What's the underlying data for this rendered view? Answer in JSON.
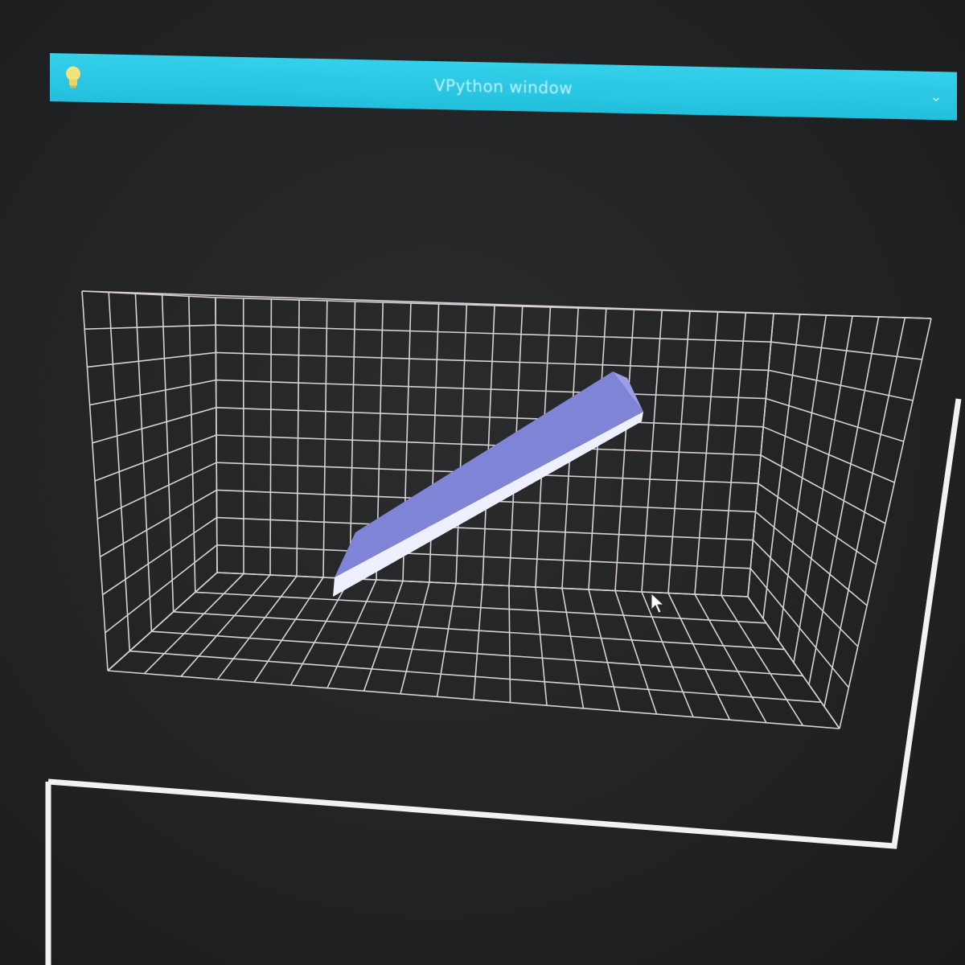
{
  "window": {
    "title": "VPython window",
    "collapse_icon": "chevron-down-icon",
    "app_icon": "lightbulb-icon"
  },
  "scene": {
    "grid_color": "#d8d0d6",
    "bar_top_color": "#7f84d6",
    "bar_side_color": "#e6e8ff",
    "background_color": "#232426",
    "titlebar_color": "#28c4df"
  }
}
